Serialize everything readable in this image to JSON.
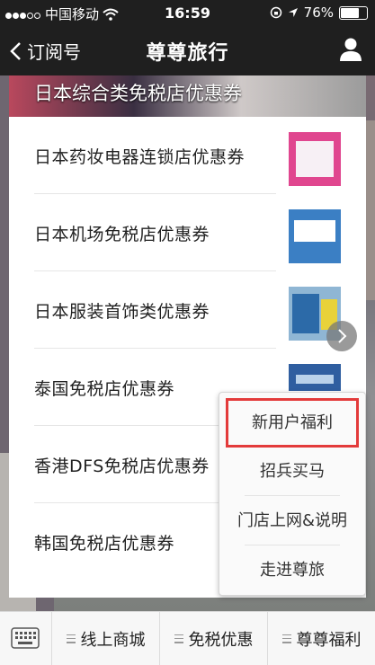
{
  "status": {
    "carrier": "中国移动",
    "time": "16:59",
    "battery": "76%",
    "battery_level": 0.76
  },
  "nav": {
    "back_label": "订阅号",
    "title": "尊尊旅行"
  },
  "banner": {
    "title": "日本综合类免税店优惠券"
  },
  "coupons": [
    {
      "label": "日本药妆电器连锁店优惠券"
    },
    {
      "label": "日本机场免税店优惠券"
    },
    {
      "label": "日本服装首饰类优惠券"
    },
    {
      "label": "泰国免税店优惠券"
    },
    {
      "label": "香港DFS免税店优惠券"
    },
    {
      "label": "韩国免税店优惠券"
    }
  ],
  "popup_menu": [
    {
      "label": "新用户福利",
      "highlighted": true
    },
    {
      "label": "招兵买马"
    },
    {
      "label": "门店上网&说明"
    },
    {
      "label": "走进尊旅"
    }
  ],
  "tabbar": {
    "tabs": [
      {
        "label": "线上商城"
      },
      {
        "label": "免税优惠"
      },
      {
        "label": "尊尊福利"
      }
    ]
  },
  "icons": [
    "keyboard-icon",
    "person-icon",
    "wifi-icon",
    "location-icon",
    "lock-rotation-icon",
    "chevron-right-icon",
    "menu-icon"
  ],
  "colors": {
    "highlight": "#e33b3b",
    "navbar": "#1f1f1f"
  }
}
